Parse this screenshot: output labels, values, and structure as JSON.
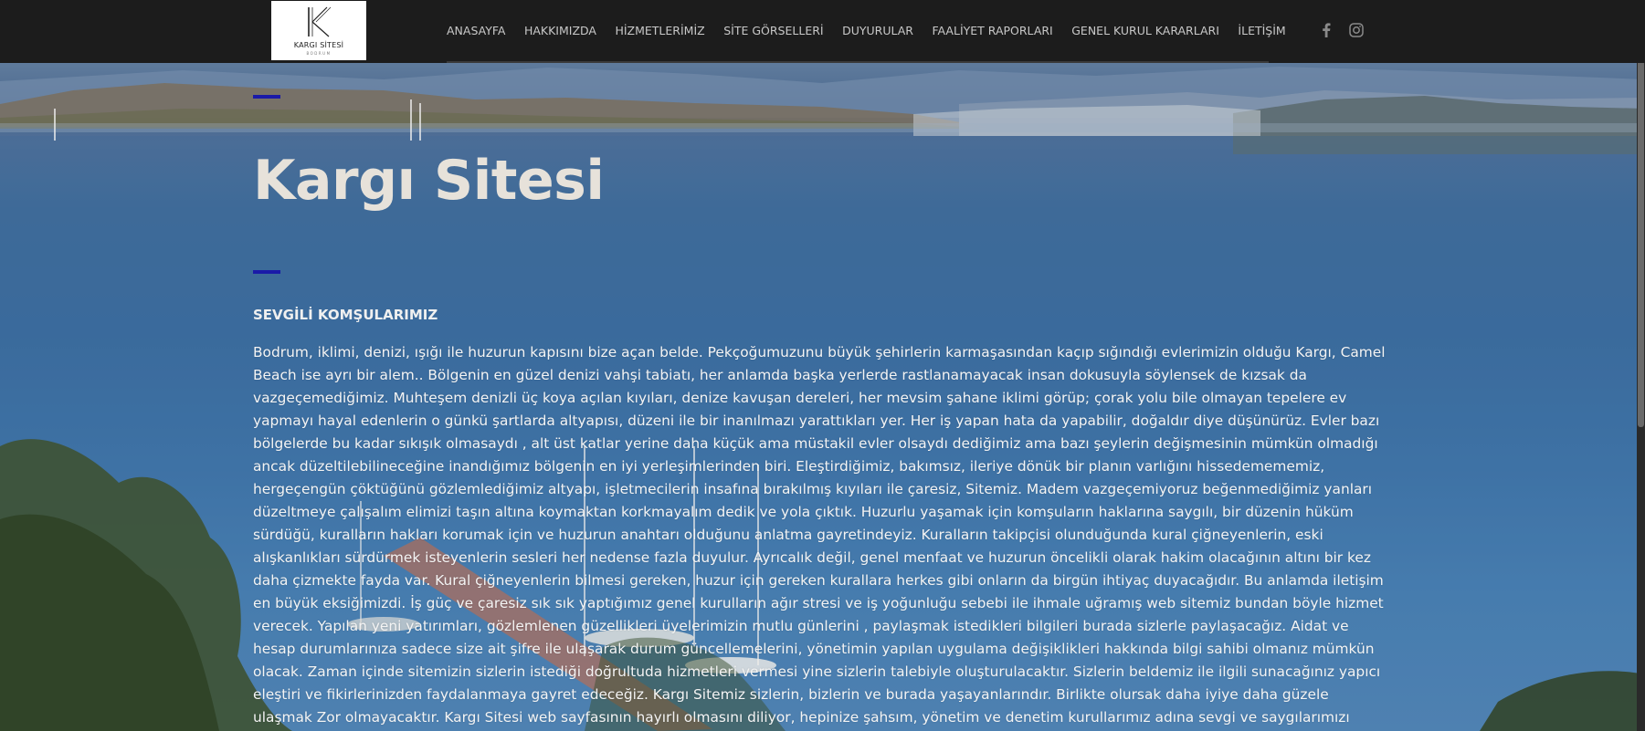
{
  "site": {
    "logo_text": "KARGI SİTESİ",
    "logo_sub": "BODRUM"
  },
  "nav": {
    "items": [
      {
        "label": "ANASAYFA"
      },
      {
        "label": "HAKKIMIZDA"
      },
      {
        "label": "HİZMETLERİMİZ"
      },
      {
        "label": "SİTE GÖRSELLERİ"
      },
      {
        "label": "DUYURULAR"
      },
      {
        "label": "FAALİYET RAPORLARI"
      },
      {
        "label": "GENEL KURUL KARARLARI"
      },
      {
        "label": "İLETİŞİM"
      }
    ],
    "social": [
      {
        "icon": "facebook-icon"
      },
      {
        "icon": "instagram-icon"
      }
    ]
  },
  "hero": {
    "title": "Kargı Sitesi",
    "subtitle": "SEVGİLİ KOMŞULARIMIZ",
    "body": "Bodrum, iklimi, denizi, ışığı ile huzurun kapısını bize açan belde. Pekçoğumuzunu büyük şehirlerin karmaşasından kaçıp sığındığı evlerimizin olduğu Kargı, Camel Beach ise ayrı bir alem.. Bölgenin en güzel denizi vahşi tabiatı, her anlamda başka yerlerde rastlanamayacak insan dokusuyla söylensek de kızsak da vazgeçemediğimiz. Muhteşem denizli üç koya açılan kıyıları, denize kavuşan dereleri, her mevsim şahane iklimi görüp; çorak yolu bile olmayan tepelere ev yapmayı hayal edenlerin o günkü şartlarda altyapısı, düzeni ile bir inanılmazı yarattıkları yer. Her iş yapan hata da yapabilir, doğaldır diye düşünürüz. Evler bazı bölgelerde bu kadar sıkışık olmasaydı , alt üst katlar yerine daha küçük ama müstakil evler olsaydı dediğimiz ama bazı şeylerin değişmesinin mümkün olmadığı ancak düzeltilebilineceğine inandığımız bölgenin en iyi yerleşimlerinden biri. Eleştirdiğimiz, bakımsız, ileriye dönük bir planın varlığını hissedemememiz, hergeçengün çöktüğünü gözlemlediğimiz altyapı, işletmecilerin insafına bırakılmış kıyıları ile çaresiz, Sitemiz. Madem vazgeçemiyoruz beğenmediğimiz yanları düzeltmeye çalışalım elimizi taşın altına koymaktan korkmayalım dedik ve yola çıktık. Huzurlu yaşamak için komşuların haklarına saygılı, bir düzenin hüküm sürdüğü, kuralların hakları korumak için ve huzurun anahtarı olduğunu anlatma gayretindeyiz. Kuralların takipçisi olunduğunda kural çiğneyenlerin, eski alışkanlıkları sürdürmek isteyenlerin sesleri her nedense fazla duyulur. Ayrıcalık değil, genel menfaat ve huzurun öncelikli olarak hakim olacağının altını bir kez daha çizmekte fayda var. Kural çiğneyenlerin bilmesi gereken, huzur için gereken kurallara herkes gibi onların da birgün ihtiyaç duyacağıdır. Bu anlamda iletişim en büyük eksiğimizdi. İş güç ve çaresiz sık sık yaptığımız genel kurulların ağır stresi ve iş yoğunluğu sebebi ile ihmale uğramış web sitemiz bundan böyle hizmet verecek. Yapılan yeni yatırımları, gözlemlenen güzellikleri üyelerimizin mutlu günlerini , paylaşmak istedikleri bilgileri burada sizlerle paylaşacağız. Aidat ve hesap durumlarınıza sadece size ait şifre ile ulaşarak durum güncellemelerini, yönetimin yapılan uygulama değişiklikleri hakkında bilgi sahibi olmanız mümkün olacak. Zaman içinde sitemizin sizlerin istediği doğrultuda hizmetleri vermesi yine sizlerin talebiyle oluşturulacaktır. Sizlerin beldemiz ile ilgili sunacağınız yapıcı eleştiri ve fikirlerinizden faydalanmaya gayret edeceğiz. Kargı Sitemiz sizlerin, bizlerin ve burada yaşayanlarındır. Birlikte olursak daha iyiye daha güzele ulaşmak Zor olmayacaktır. Kargı Sitesi web sayfasının hayırlı olmasını diliyor, hepinize şahsım, yönetim ve denetim kurullarımız adına sevgi ve saygılarımızı sunuyorum."
  },
  "colors": {
    "header_bg": "#1c1c1c",
    "accent": "#1a1aa8",
    "nav_text": "#c8c8c8",
    "title": "#e7e2da"
  }
}
